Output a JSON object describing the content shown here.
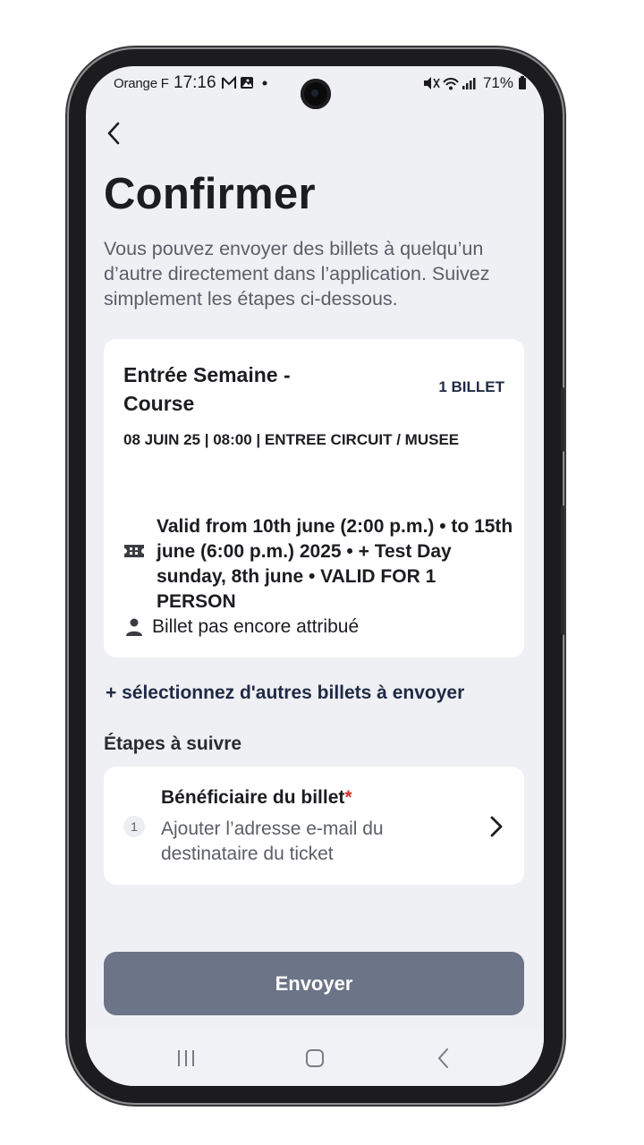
{
  "status_bar": {
    "carrier": "Orange F",
    "time": "17:16",
    "battery": "71%"
  },
  "page": {
    "title": "Confirmer",
    "description": "Vous pouvez envoyer des billets à quelqu’un d’autre directement dans l’application. Suivez simplement les étapes ci-dessous."
  },
  "ticket": {
    "name": "Entrée Semaine - Course",
    "count": "1 BILLET",
    "date_line": "08 JUIN 25 | 08:00 | ENTREE CIRCUIT / MUSEE",
    "validity": "Valid from 10th june (2:00 p.m.) • to 15th june (6:00 p.m.) 2025 • + Test Day sunday, 8th june • VALID FOR 1 PERSON",
    "assignment": "Billet pas encore attribué"
  },
  "more_tickets_link": "+ sélectionnez d'autres billets à envoyer",
  "steps": {
    "heading": "Étapes à suivre",
    "items": [
      {
        "number": "1",
        "title": "Bénéficiaire du billet",
        "required_mark": "*",
        "subtitle": "Ajouter l’adresse e-mail du destinataire du ticket"
      }
    ]
  },
  "send_button": "Envoyer",
  "colors": {
    "background": "#eff0f4",
    "accent_dark": "#1f2a44",
    "button_disabled": "#6c7488",
    "required": "#d93025"
  },
  "icons": [
    "back-chevron-icon",
    "ticket-icon",
    "person-icon",
    "chevron-right-icon",
    "recents-icon",
    "home-icon",
    "nav-back-icon"
  ]
}
